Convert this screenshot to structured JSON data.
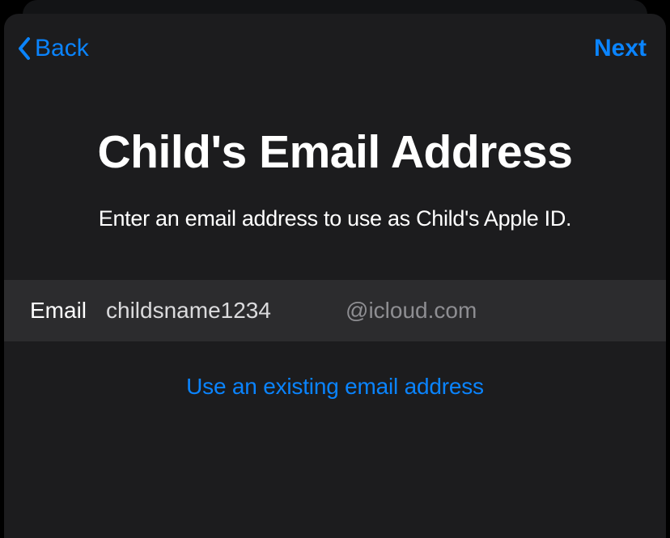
{
  "nav": {
    "back_label": "Back",
    "next_label": "Next"
  },
  "page": {
    "title": "Child's Email Address",
    "subtitle": "Enter an email address to use as Child's Apple ID."
  },
  "email": {
    "label": "Email",
    "value": "childsname1234",
    "domain": "@icloud.com"
  },
  "link": {
    "use_existing": "Use an existing email address"
  }
}
